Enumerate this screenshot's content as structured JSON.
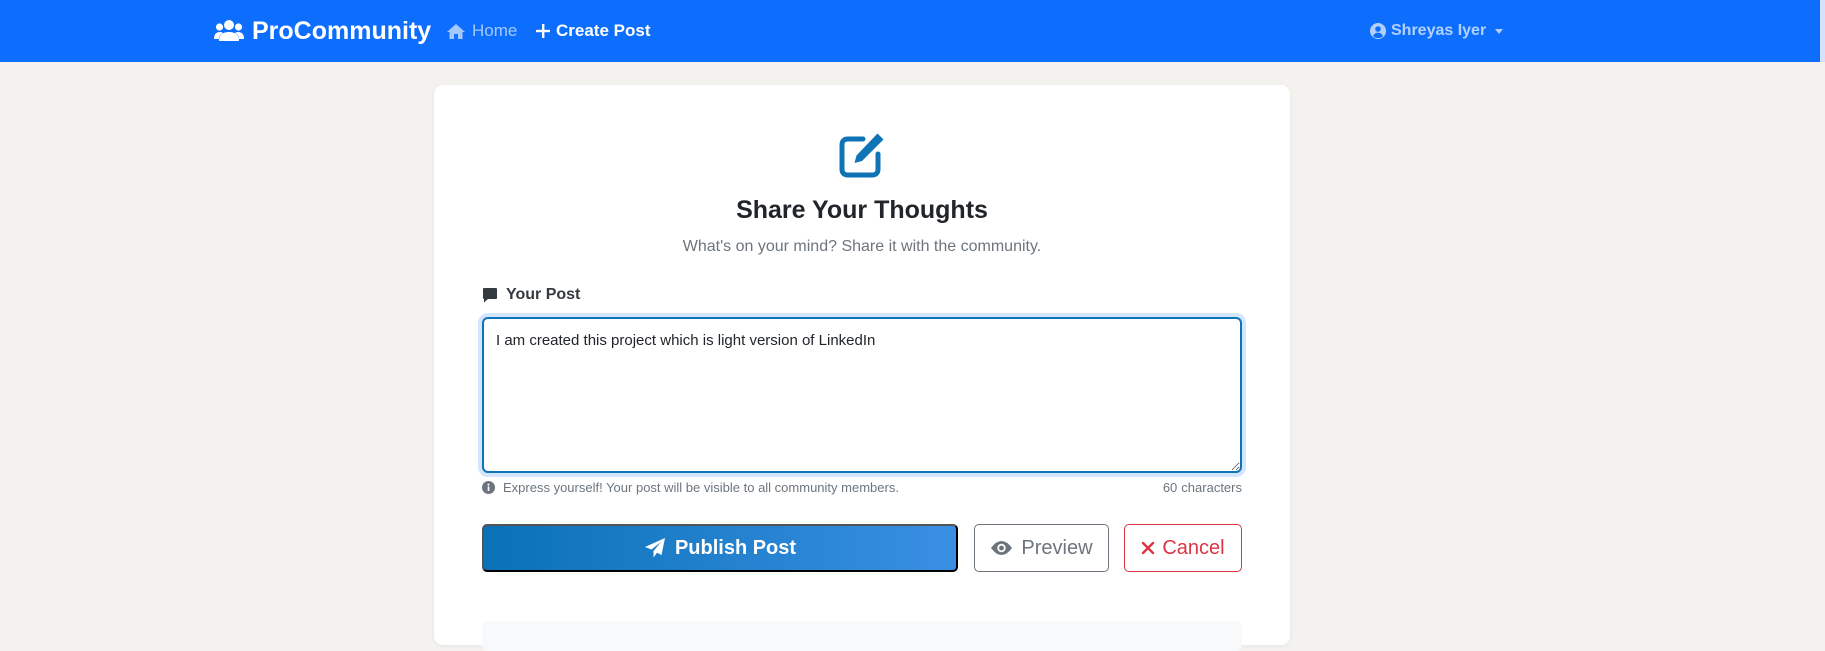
{
  "navbar": {
    "brand": "ProCommunity",
    "brand_icon": "users-icon",
    "links": [
      {
        "label": "Home",
        "icon": "home-icon"
      },
      {
        "label": "Create Post",
        "icon": "plus-icon"
      }
    ],
    "user": {
      "name": "Shreyas Iyer",
      "icon": "user-circle-icon"
    }
  },
  "form": {
    "header_icon": "edit-icon",
    "title": "Share Your Thoughts",
    "subtitle": "What's on your mind? Share it with the community.",
    "label": "Your Post",
    "label_icon": "comment-icon",
    "post_text": "I am created this project which is light version of LinkedIn",
    "hint": "Express yourself! Your post will be visible to all community members.",
    "hint_icon": "info-icon",
    "char_count": "60",
    "char_suffix": "characters",
    "buttons": {
      "publish": "Publish Post",
      "preview": "Preview",
      "cancel": "Cancel"
    }
  },
  "colors": {
    "navbar": "#0d6efd",
    "accent": "#0f74b5",
    "danger": "#dc3545",
    "muted": "#6c757d",
    "background": "#f3f2ef"
  }
}
